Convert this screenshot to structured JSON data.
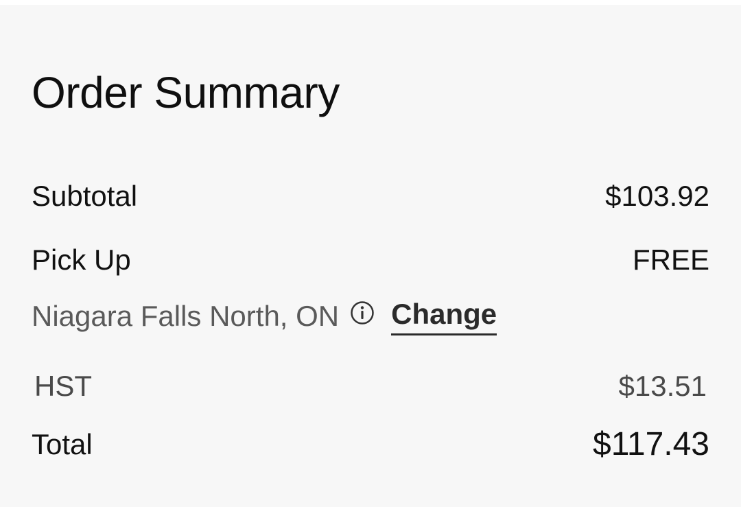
{
  "order_summary": {
    "title": "Order Summary",
    "subtotal": {
      "label": "Subtotal",
      "value": "$103.92"
    },
    "pickup": {
      "label": "Pick Up",
      "value": "FREE",
      "store": "Niagara Falls North, ON",
      "info_icon": "info-circle-icon",
      "change_label": "Change"
    },
    "tax": {
      "label": "HST",
      "value": "$13.51"
    },
    "total": {
      "label": "Total",
      "value": "$117.43"
    }
  }
}
